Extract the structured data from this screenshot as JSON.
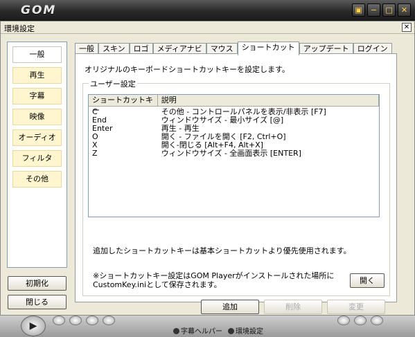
{
  "player": {
    "logo": "GOM",
    "window_buttons": [
      "▣",
      "−",
      "□",
      "✕"
    ]
  },
  "dialog": {
    "title": "環境設定",
    "close_label": "✕"
  },
  "nav": {
    "items": [
      {
        "label": "一般",
        "active": true
      },
      {
        "label": "再生",
        "active": false
      },
      {
        "label": "字幕",
        "active": false
      },
      {
        "label": "映像",
        "active": false
      },
      {
        "label": "オーディオ",
        "active": false
      },
      {
        "label": "フィルタ",
        "active": false
      },
      {
        "label": "その他",
        "active": false
      }
    ],
    "init_button": "初期化",
    "close_button": "閉じる"
  },
  "tabs": [
    {
      "label": "一般",
      "active": false
    },
    {
      "label": "スキン",
      "active": false
    },
    {
      "label": "ロゴ",
      "active": false
    },
    {
      "label": "メディアナビ",
      "active": false
    },
    {
      "label": "マウス",
      "active": false
    },
    {
      "label": "ショートカット",
      "active": true
    },
    {
      "label": "アップデート",
      "active": false
    },
    {
      "label": "ログイン",
      "active": false
    }
  ],
  "panel": {
    "description": "オリジナルのキーボードショートカットキーを設定します。",
    "group_label": "ユーザー設定",
    "list_headers": {
      "key": "ショートカットキー",
      "desc": "説明"
    },
    "rows": [
      {
        "key": "C",
        "desc": "その他 - コントロールパネルを表示/非表示 [F7]"
      },
      {
        "key": "End",
        "desc": "ウィンドウサイズ - 最小サイズ [@]"
      },
      {
        "key": "Enter",
        "desc": "再生 - 再生"
      },
      {
        "key": "O",
        "desc": "開く - ファイルを開く [F2, Ctrl+O]"
      },
      {
        "key": "X",
        "desc": "開く-閉じる [Alt+F4, Alt+X]"
      },
      {
        "key": "Z",
        "desc": "ウィンドウサイズ - 全画面表示 [ENTER]"
      }
    ],
    "note1": "追加したショートカットキーは基本ショートカットより優先使用されます。",
    "note2_line1": "※ショートカットキー設定はGOM Playerがインストールされた場所に",
    "note2_line2": "CustomKey.iniとして保存されます。",
    "open_button": "開く",
    "add_button": "追加",
    "delete_button": "削除",
    "edit_button": "変更"
  },
  "footer": {
    "subtitle_helper": "字幕ヘルパー",
    "settings": "環境設定",
    "play_icon": "▶"
  }
}
